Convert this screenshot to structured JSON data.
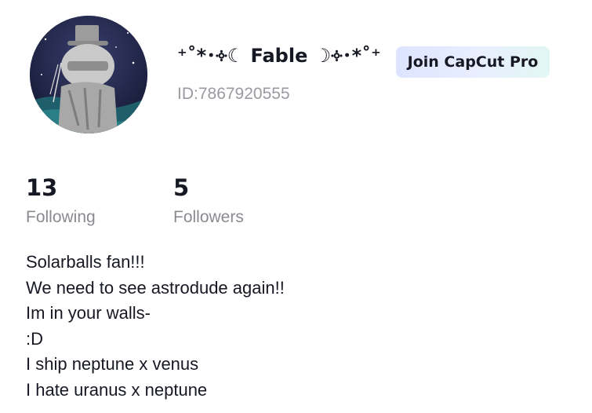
{
  "profile": {
    "display_name": "⁺˚*･༓☾ Fable ☽༓･*˚⁺",
    "user_id": "ID:7867920555",
    "pro_button_label": "Join CapCut Pro"
  },
  "stats": {
    "following_count": "13",
    "following_label": "Following",
    "followers_count": "5",
    "followers_label": "Followers"
  },
  "bio": {
    "lines": [
      "Solarballs fan!!!",
      "We need to see astrodude again!!",
      "Im in your walls-",
      ":D",
      "I ship neptune x venus",
      "I hate uranus x neptune"
    ]
  },
  "colors": {
    "text_primary": "#161823",
    "text_secondary": "#8a8b91",
    "pro_gradient_start": "#dde4ff",
    "pro_gradient_end": "#e2f7f3"
  }
}
